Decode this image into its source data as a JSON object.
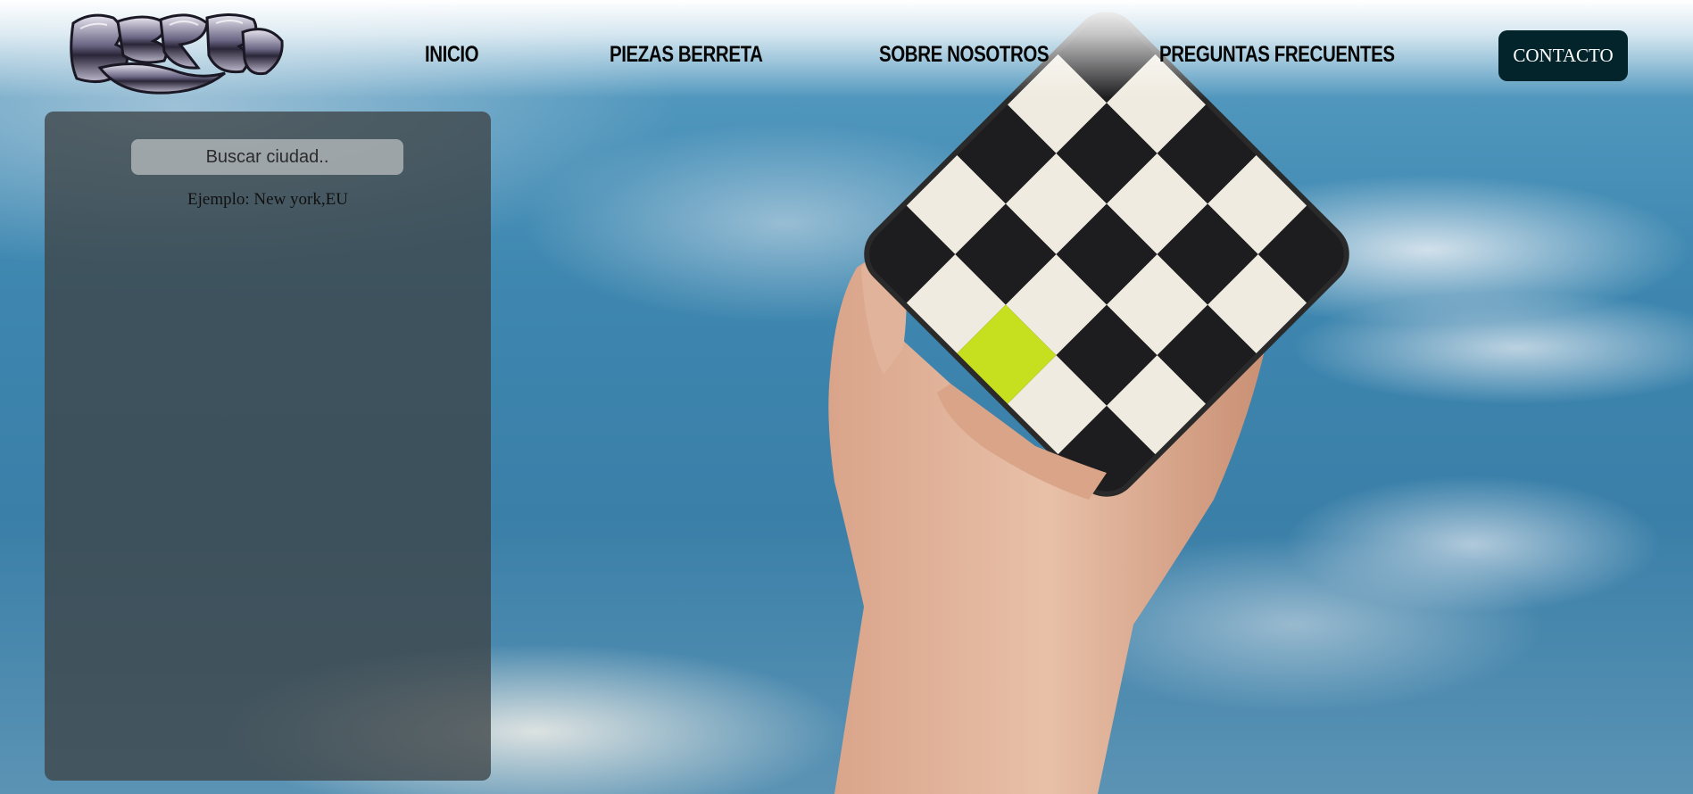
{
  "brand": {
    "logo_text": "BERRETA",
    "logo_icon": "graffiti-chrome-logo"
  },
  "nav": {
    "items": [
      {
        "label": "INICIO"
      },
      {
        "label": "PIEZAS BERRETA"
      },
      {
        "label": "SOBRE NOSOTROS"
      },
      {
        "label": "PREGUNTAS FRECUENTES"
      }
    ],
    "contact_label": "CONTACTO"
  },
  "weather_panel": {
    "search_placeholder": "Buscar ciudad..",
    "search_value": "",
    "example_text": "Ejemplo: New york,EU"
  },
  "colors": {
    "contact_button": "#03242b",
    "panel_bg": "rgba(62,68,70,0.78)",
    "accent_tile": "#c6df1f",
    "sky": "#3e87b0"
  },
  "hero_image": {
    "subject": "hand-holding-checkerboard-glass-tile"
  }
}
